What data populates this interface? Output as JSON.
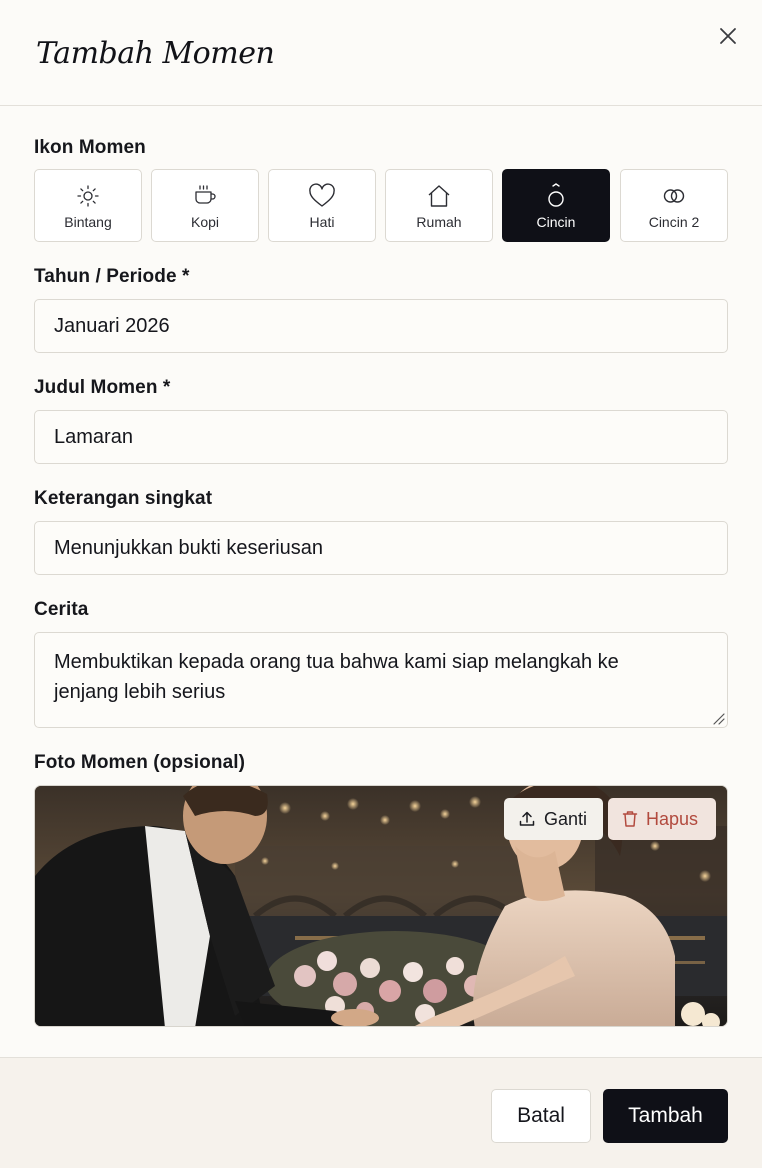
{
  "dialog": {
    "title": "Tambah Momen"
  },
  "form": {
    "icon_label": "Ikon Momen",
    "icons": [
      {
        "label": "Bintang",
        "icon": "sun-icon",
        "selected": false
      },
      {
        "label": "Kopi",
        "icon": "coffee-cup-icon",
        "selected": false
      },
      {
        "label": "Hati",
        "icon": "heart-icon",
        "selected": false
      },
      {
        "label": "Rumah",
        "icon": "house-icon",
        "selected": false
      },
      {
        "label": "Cincin",
        "icon": "ring-icon",
        "selected": true
      },
      {
        "label": "Cincin 2",
        "icon": "double-rings-icon",
        "selected": false
      }
    ],
    "year_label": "Tahun / Periode *",
    "year_value": "Januari 2026",
    "title_label": "Judul Momen *",
    "title_value": "Lamaran",
    "desc_label": "Keterangan singkat",
    "desc_value": "Menunjukkan bukti keseriusan",
    "story_label": "Cerita",
    "story_value": "Membuktikan kepada orang tua bahwa kami siap melangkah ke jenjang lebih serius",
    "photo_label": "Foto Momen (opsional)",
    "photo_replace_label": "Ganti",
    "photo_delete_label": "Hapus"
  },
  "footer": {
    "cancel_label": "Batal",
    "submit_label": "Tambah"
  },
  "colors": {
    "primary": "#0f1017",
    "danger": "#b24a3e",
    "background": "#fcfbf8",
    "footer_bg": "#f6f2ec"
  }
}
